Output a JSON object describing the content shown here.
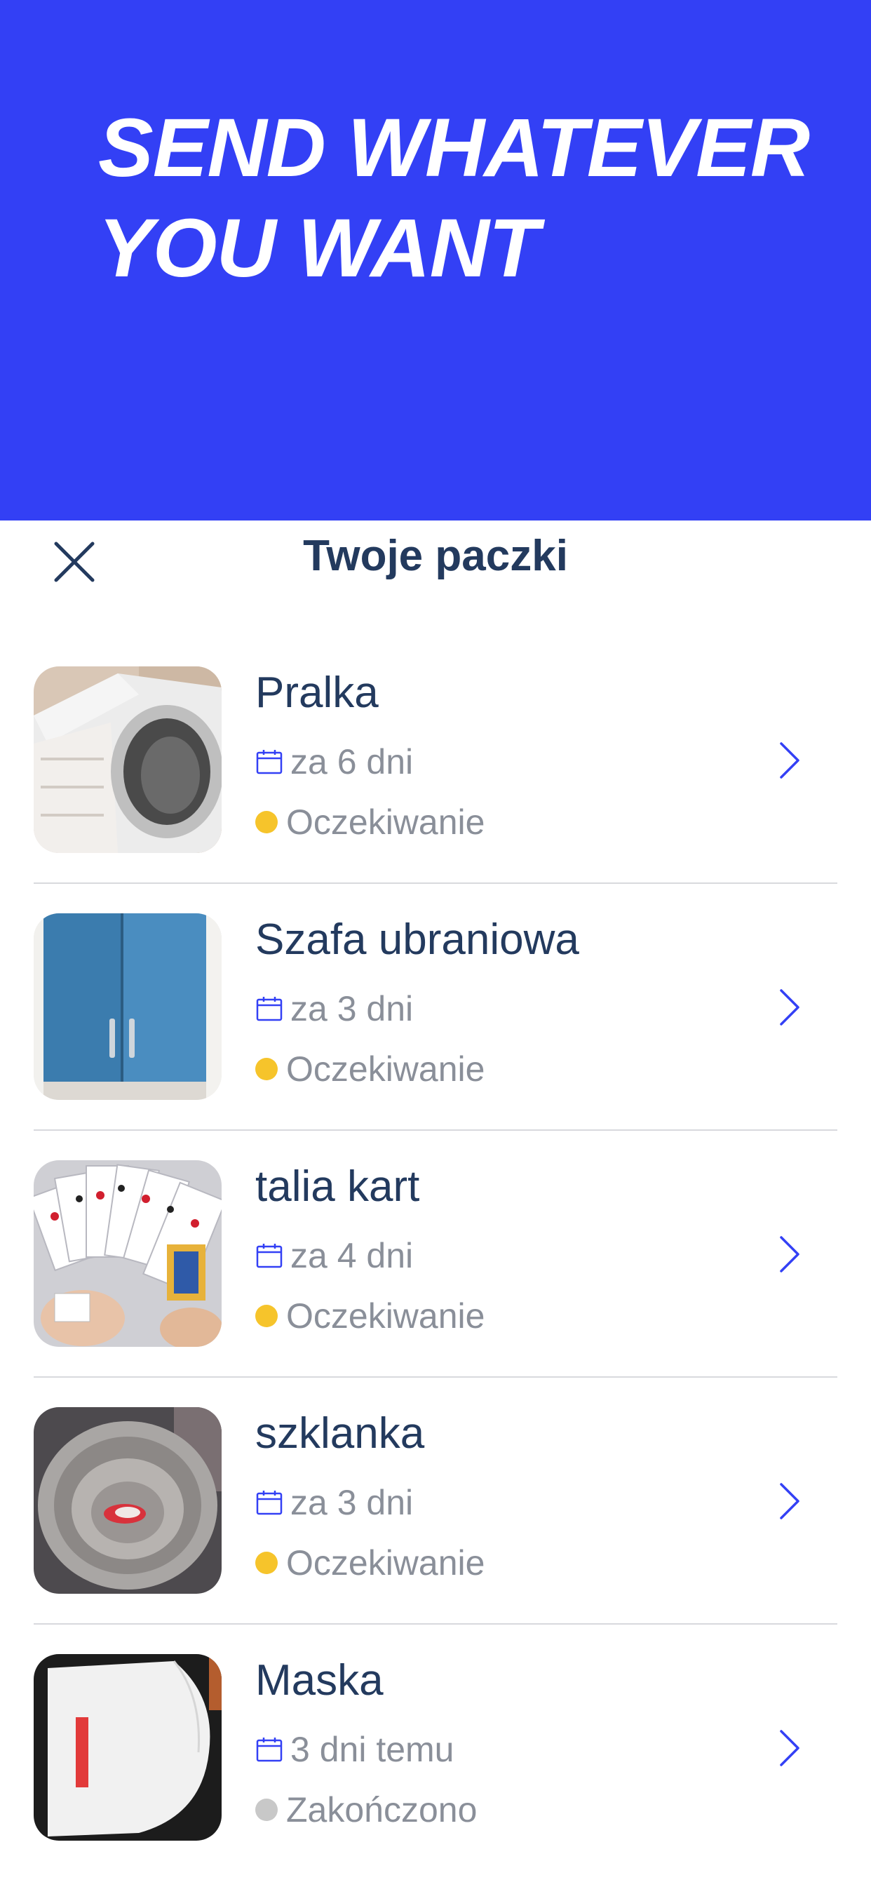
{
  "hero": {
    "line1": "SEND WHATEVER",
    "line2": "YOU WANT"
  },
  "sheet": {
    "title": "Twoje paczki"
  },
  "items": [
    {
      "name": "Pralka",
      "date": "za 6 dni",
      "status": "Oczekiwanie",
      "status_color": "#f6c42b",
      "image": "washing-machine-photo"
    },
    {
      "name": "Szafa ubraniowa",
      "date": "za 3 dni",
      "status": "Oczekiwanie",
      "status_color": "#f6c42b",
      "image": "wardrobe-photo"
    },
    {
      "name": "talia kart",
      "date": "za 4 dni",
      "status": "Oczekiwanie",
      "status_color": "#f6c42b",
      "image": "playing-cards-photo"
    },
    {
      "name": "szklanka",
      "date": "za 3 dni",
      "status": "Oczekiwanie",
      "status_color": "#f6c42b",
      "image": "glass-photo"
    },
    {
      "name": "Maska",
      "date": "3 dni temu",
      "status": "Zakończono",
      "status_color": "#c8c8c8",
      "image": "face-mask-photo"
    }
  ],
  "colors": {
    "accent": "#3340f5",
    "title": "#233a5e",
    "muted": "#8a8f99"
  }
}
